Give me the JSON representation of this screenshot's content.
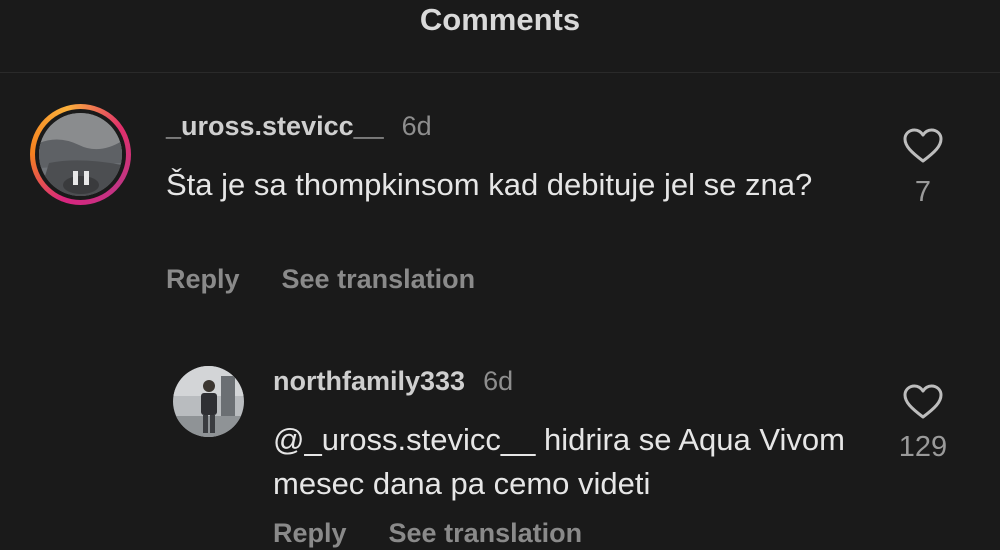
{
  "header": {
    "title": "Comments"
  },
  "comments": [
    {
      "username": "_uross.stevicc__",
      "age": "6d",
      "text": "Šta je sa thompkinsom kad debituje jel se zna?",
      "reply_label": "Reply",
      "translate_label": "See translation",
      "like_count": "7",
      "like_icon": "heart-outline-icon",
      "story_ring": true
    },
    {
      "username": "northfamily333",
      "age": "6d",
      "text": "@_uross.stevicc__ hidrira se Aqua Vivom mesec dana pa cemo videti",
      "reply_label": "Reply",
      "translate_label": "See translation",
      "like_count": "129",
      "like_icon": "heart-outline-icon",
      "story_ring": false
    }
  ],
  "colors": {
    "background": "#1a1a1a",
    "ring_gradient": [
      "#d8257f",
      "#f5811f",
      "#fbb03b"
    ]
  }
}
